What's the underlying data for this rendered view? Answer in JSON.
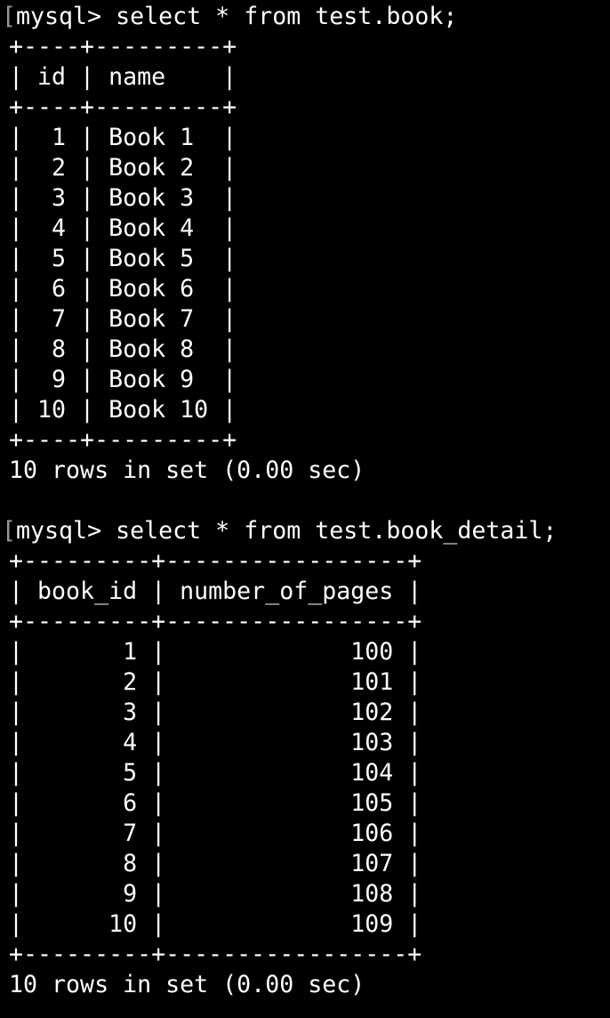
{
  "session": {
    "queries": [
      {
        "prompt": "mysql>",
        "command": "select * from test.book;",
        "border": "+----+---------+",
        "header": "| id | name    |",
        "rows": [
          "|  1 | Book 1  |",
          "|  2 | Book 2  |",
          "|  3 | Book 3  |",
          "|  4 | Book 4  |",
          "|  5 | Book 5  |",
          "|  6 | Book 6  |",
          "|  7 | Book 7  |",
          "|  8 | Book 8  |",
          "|  9 | Book 9  |",
          "| 10 | Book 10 |"
        ],
        "summary": "10 rows in set (0.00 sec)"
      },
      {
        "prompt": "mysql>",
        "command": "select * from test.book_detail;",
        "border": "+---------+-----------------+",
        "header": "| book_id | number_of_pages |",
        "rows": [
          "|       1 |             100 |",
          "|       2 |             101 |",
          "|       3 |             102 |",
          "|       4 |             103 |",
          "|       5 |             104 |",
          "|       6 |             105 |",
          "|       7 |             106 |",
          "|       8 |             107 |",
          "|       9 |             108 |",
          "|      10 |             109 |"
        ],
        "summary": "10 rows in set (0.00 sec)"
      }
    ]
  },
  "colors": {
    "background": "#000000",
    "text": "#ffffff"
  }
}
